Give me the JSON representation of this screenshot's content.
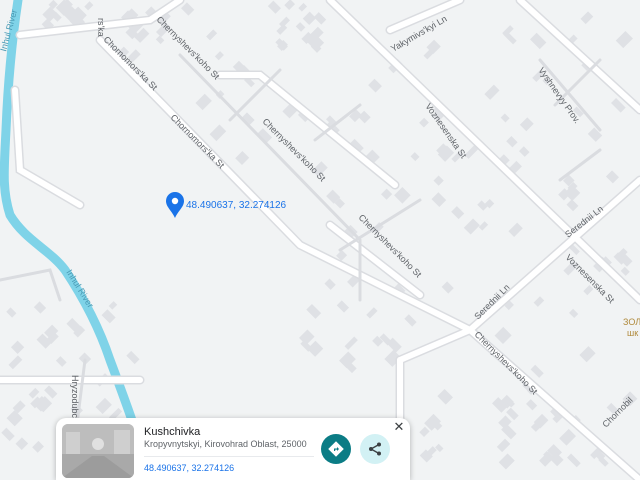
{
  "map": {
    "pin": {
      "coordinates_label": "48.490637, 32.274126"
    },
    "streets": {
      "chornomorska_top": "rs'ka",
      "chornomorska_1": "Chornomors'ka St",
      "chornomorska_2": "Chornomors'ka St",
      "chernyshevskoho_1": "Chernyshevs'koho St",
      "chernyshevskoho_2": "Chernyshevs'koho St",
      "chernyshevskoho_3": "Chernyshevs'koho St",
      "chernyshevskoho_4": "Chernyshevs'koho St",
      "yakymivskyi": "Yakymivs'kyi Ln",
      "voznesenska_1": "Voznesenska St",
      "voznesenska_2": "Voznesenska St",
      "vyshnevyy": "Vyshnevyy Prov.",
      "serednii_ln": "Serednii Ln",
      "serednii_small": "Serednii Ln",
      "hryzodub": "Hryzodubc",
      "chornobyl": "Chornobil",
      "top_k": "k"
    },
    "rivers": {
      "inhul_1": "Inhul River",
      "inhul_2": "Inhul River"
    },
    "poi": {
      "zol": "ЗОЛ",
      "shk": "шк"
    }
  },
  "place_card": {
    "title": "Kushchivka",
    "address": "Kropyvnytskyi, Kirovohrad Oblast, 25000",
    "coordinates": "48.490637, 32.274126",
    "close_glyph": "✕"
  },
  "colors": {
    "background": "#f1f3f4",
    "river": "#7fd3e8",
    "road": "#ffffff",
    "road_outline": "#dadce0",
    "building": "#dfe1e5",
    "pin": "#1a73e8",
    "directions_button": "#0b7c85",
    "share_button": "#d2f1f4"
  },
  "icons": {
    "pin": "location-pin-icon",
    "directions": "directions-icon",
    "share": "share-icon",
    "close": "close-icon"
  }
}
